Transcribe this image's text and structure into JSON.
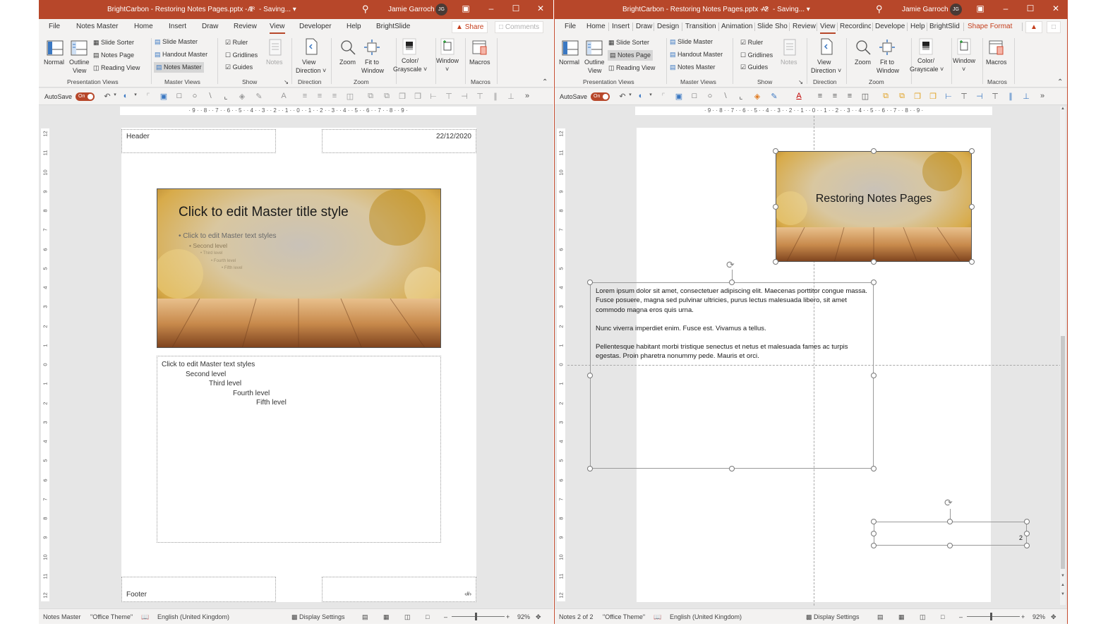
{
  "windows": [
    {
      "title": "BrightCarbon - Restoring Notes Pages.pptx  -  1",
      "saving": "-  Saving...  ▾",
      "user": "Jamie Garroch",
      "initials": "JG",
      "tabs": [
        "File",
        "Notes Master",
        "Home",
        "Insert",
        "Draw",
        "Review",
        "View",
        "Developer",
        "Help",
        "BrightSlide"
      ],
      "active_tab": "View",
      "share": "Share",
      "comments": "Comments",
      "ribbon": {
        "presentation_views": {
          "normal": "Normal",
          "outline": "Outline",
          "outline2": "View",
          "slide_sorter": "Slide Sorter",
          "notes_page": "Notes Page",
          "reading_view": "Reading View",
          "group": "Presentation Views"
        },
        "master_views": {
          "slide_master": "Slide Master",
          "handout_master": "Handout Master",
          "notes_master": "Notes Master",
          "group": "Master Views"
        },
        "show": {
          "ruler": "Ruler",
          "gridlines": "Gridlines",
          "guides": "Guides",
          "notes": "Notes",
          "group": "Show",
          "ruler_checked": true,
          "gridlines_checked": false,
          "guides_checked": true
        },
        "direction": {
          "view": "View",
          "direction": "Direction ˅",
          "group": "Direction"
        },
        "zoom": {
          "zoom": "Zoom",
          "fit": "Fit to",
          "window": "Window",
          "group": "Zoom"
        },
        "color": {
          "l1": "Color/",
          "l2": "Grayscale ˅"
        },
        "window": {
          "l1": "Window",
          "l2": "˅"
        },
        "macros": {
          "l1": "Macros",
          "group": "Macros"
        }
      },
      "autosave": "AutoSave",
      "autosave_state": "On",
      "hruler": "· 9 · · 8 · · 7 · · 6 · · 5 · · 4 · · 3 · · 2 · · 1 · · 0 · · 1 · · 2 · · 3 · · 4 · · 5 · · 6 · · 7 · · 8 · · 9 ·",
      "notes_master": {
        "header": "Header",
        "date": "22/12/2020",
        "slide_title": "Click to edit Master title style",
        "slide_levels": [
          "Click to edit Master text styles",
          "Second level",
          "Third level",
          "Fourth level",
          "Fifth level"
        ],
        "body_levels": [
          "Click to edit Master text styles",
          "Second level",
          "Third level",
          "Fourth level",
          "Fifth level"
        ],
        "footer": "Footer",
        "page_number": "‹#›"
      },
      "status": {
        "view": "Notes Master",
        "theme": "\"Office Theme\"",
        "language": "English (United Kingdom)",
        "display": "Display Settings",
        "zoom": "92%",
        "minus": "–",
        "plus": "+"
      }
    },
    {
      "title": "BrightCarbon - Restoring Notes Pages.pptx  -  2",
      "saving": "-  Saving...  ▾",
      "user": "Jamie Garroch",
      "initials": "JG",
      "tabs": [
        "File",
        "Home",
        "Insert",
        "Draw",
        "Design",
        "Transition",
        "Animation",
        "Slide Sho",
        "Review",
        "View",
        "Recordinc",
        "Develope",
        "Help",
        "BrightSlid",
        "Shape Format"
      ],
      "active_tab": "View",
      "ribbon": {
        "presentation_views": {
          "normal": "Normal",
          "outline": "Outline",
          "outline2": "View",
          "slide_sorter": "Slide Sorter",
          "notes_page": "Notes Page",
          "reading_view": "Reading View",
          "group": "Presentation Views"
        },
        "master_views": {
          "slide_master": "Slide Master",
          "handout_master": "Handout Master",
          "notes_master": "Notes Master",
          "group": "Master Views"
        },
        "show": {
          "ruler": "Ruler",
          "gridlines": "Gridlines",
          "guides": "Guides",
          "notes": "Notes",
          "group": "Show"
        },
        "direction": {
          "view": "View",
          "direction": "Direction ˅",
          "group": "Direction"
        },
        "zoom": {
          "zoom": "Zoom",
          "fit": "Fit to",
          "window": "Window",
          "group": "Zoom"
        },
        "color": {
          "l1": "Color/",
          "l2": "Grayscale ˅"
        },
        "window": {
          "l1": "Window",
          "l2": "˅"
        },
        "macros": {
          "l1": "Macros",
          "group": "Macros"
        }
      },
      "autosave": "AutoSave",
      "autosave_state": "On",
      "hruler": "· 9 · · 8 · · 7 · · 6 · · 5 · · 4 · · 3 · · 2 · · 1 · · 0 · · 1 · · 2 · · 3 · · 4 · · 5 · · 6 · · 7 · · 8 · · 9 ·",
      "notes_page": {
        "slide_title": "Restoring Notes Pages",
        "paragraphs": [
          "Lorem ipsum dolor sit amet, consectetuer adipiscing elit. Maecenas porttitor congue massa. Fusce posuere, magna sed pulvinar ultricies, purus lectus malesuada libero, sit amet commodo magna eros quis urna.",
          "Nunc viverra imperdiet enim. Fusce est. Vivamus a tellus.",
          "Pellentesque habitant morbi tristique senectus et netus et malesuada fames ac turpis egestas. Proin pharetra nonummy pede. Mauris et orci."
        ],
        "page_number": "2"
      },
      "status": {
        "view": "Notes 2 of 2",
        "theme": "\"Office Theme\"",
        "language": "English (United Kingdom)",
        "display": "Display Settings",
        "zoom": "92%",
        "minus": "–",
        "plus": "+"
      }
    }
  ],
  "vruler_labels": [
    "12",
    "11",
    "10",
    "9",
    "8",
    "7",
    "6",
    "5",
    "4",
    "3",
    "2",
    "1",
    "0",
    "1",
    "2",
    "3",
    "4",
    "5",
    "6",
    "7",
    "8",
    "9",
    "10",
    "11",
    "12"
  ],
  "colors": {
    "accent": "#b7472a",
    "ribbon_bg": "#f3f2f1",
    "canvas_bg": "#e6e6e6"
  }
}
